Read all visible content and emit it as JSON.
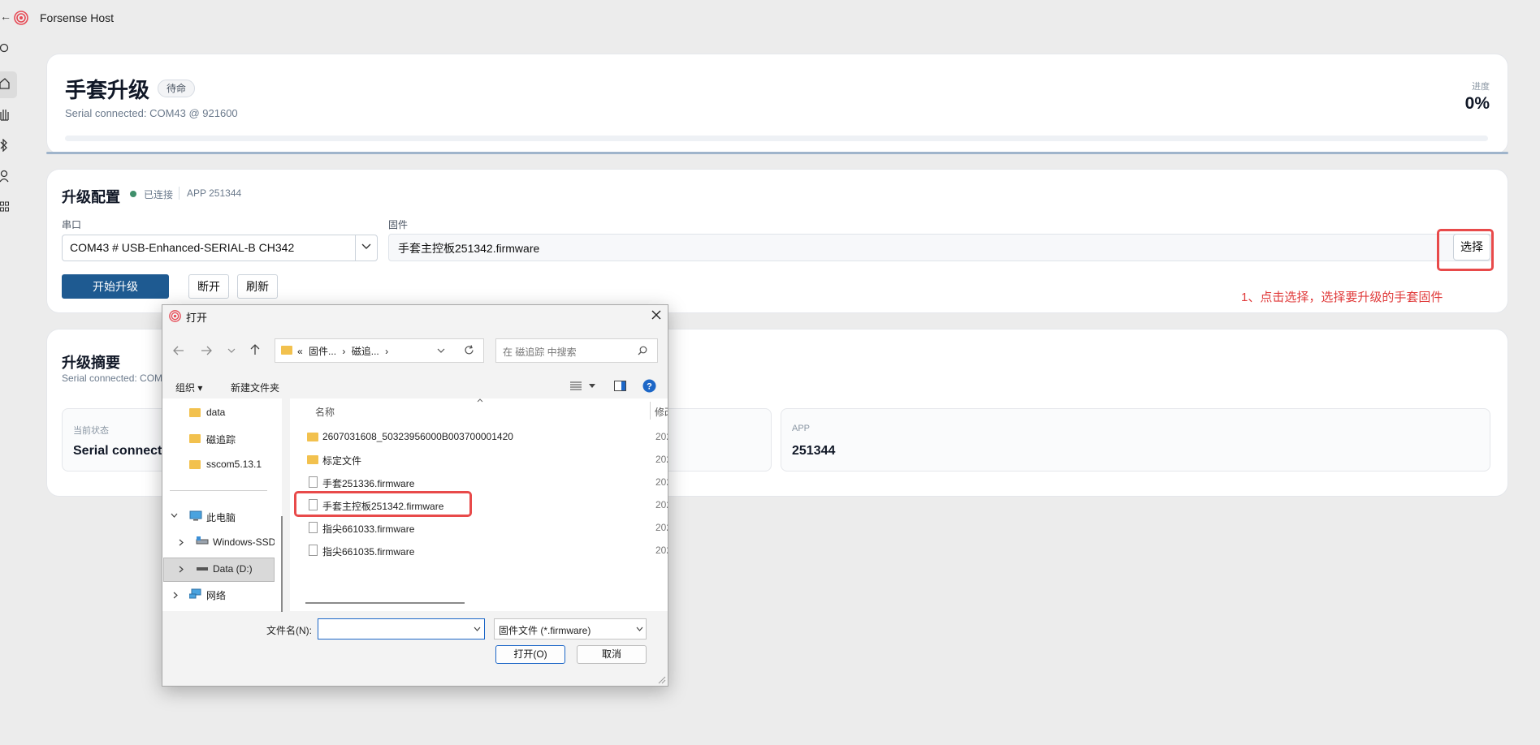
{
  "app": {
    "title": "Forsense Host",
    "back_glyph": "←"
  },
  "rail_icons": [
    "circle-icon",
    "home-icon",
    "glove-icon",
    "bluetooth-icon",
    "user-icon",
    "apps-icon"
  ],
  "status_card": {
    "title": "手套升级",
    "badge": "待命",
    "subtitle": "Serial connected: COM43 @ 921600",
    "progress_label": "进度",
    "progress_value": "0%",
    "progress_fraction": 0
  },
  "config_card": {
    "title": "升级配置",
    "status": "已连接",
    "app_version": "APP 251344",
    "port_label": "串口",
    "port_value": "COM43 # USB-Enhanced-SERIAL-B CH342",
    "firmware_label": "固件",
    "firmware_value": "手套主控板251342.firmware",
    "choose_label": "选择",
    "hint": "1、点击选择，选择要升级的手套固件",
    "start_label": "开始升级",
    "disconnect_label": "断开",
    "refresh_label": "刷新"
  },
  "summary_card": {
    "title": "升级摘要",
    "subtitle": "Serial connected: COM",
    "stats": [
      {
        "label": "当前状态",
        "value": "Serial connecte"
      },
      {
        "label": "APP",
        "value": "251344"
      }
    ]
  },
  "dialog": {
    "title": "打开",
    "breadcrumb": [
      "«",
      "固件...",
      "›",
      "磁追...",
      "›"
    ],
    "search_placeholder": "在 磁追踪 中搜索",
    "organize": "组织 ▾",
    "new_folder": "新建文件夹",
    "col_name": "名称",
    "col_modified": "修改",
    "nav_items": [
      {
        "label": "data",
        "type": "folder"
      },
      {
        "label": "磁追踪",
        "type": "folder"
      },
      {
        "label": "sscom5.13.1",
        "type": "folder"
      },
      {
        "label": "此电脑",
        "type": "pc"
      },
      {
        "label": "Windows-SSD",
        "type": "drive"
      },
      {
        "label": "Data (D:)",
        "type": "drive"
      },
      {
        "label": "网络",
        "type": "network"
      }
    ],
    "files": [
      {
        "name": "2607031608_50323956000B003700001420",
        "type": "folder",
        "date": "202"
      },
      {
        "name": "标定文件",
        "type": "folder",
        "date": "202"
      },
      {
        "name": "手套251336.firmware",
        "type": "file",
        "date": "202"
      },
      {
        "name": "手套主控板251342.firmware",
        "type": "file",
        "date": "202"
      },
      {
        "name": "指尖661033.firmware",
        "type": "file",
        "date": "202"
      },
      {
        "name": "指尖661035.firmware",
        "type": "file",
        "date": "202"
      }
    ],
    "filename_label": "文件名(N):",
    "filename_value": "",
    "filetype_value": "固件文件 (*.firmware)",
    "open_label": "打开(O)",
    "cancel_label": "取消"
  },
  "colors": {
    "accent": "#1e5a91",
    "annotation_red": "#e84a4a",
    "connected_dot": "#3f8f6b",
    "folder": "#f2c14e"
  }
}
